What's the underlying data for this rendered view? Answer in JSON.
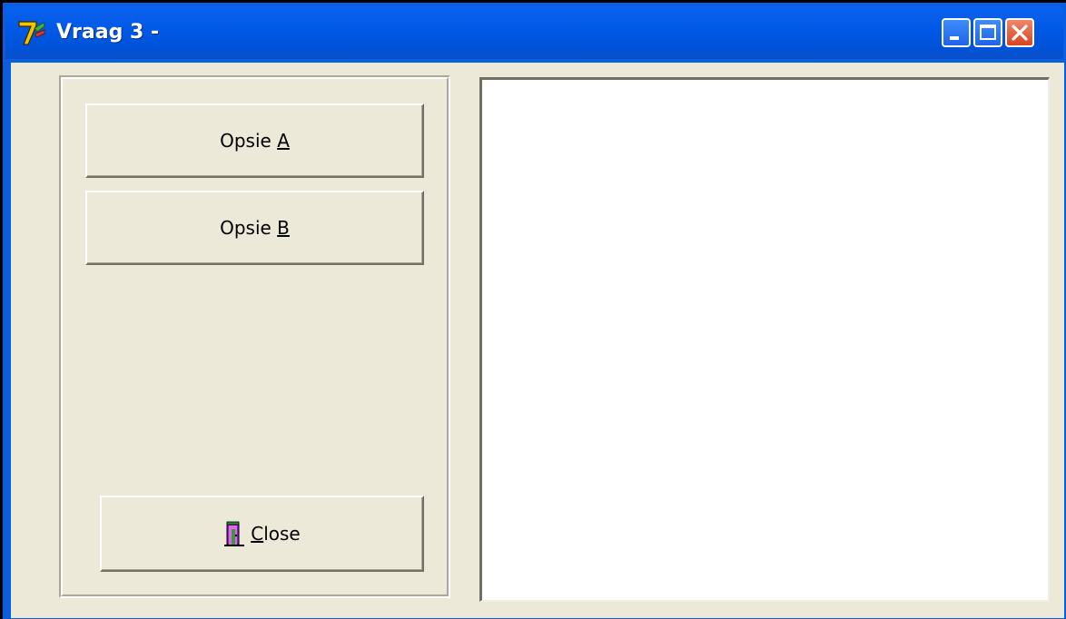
{
  "window": {
    "title": "Vraag 3 -",
    "icon": "app-logo-icon",
    "controls": [
      "minimize-icon",
      "maximize-icon",
      "close-icon"
    ]
  },
  "buttons": {
    "option_a": {
      "prefix": "Opsie ",
      "accel": "A",
      "suffix": ""
    },
    "option_b": {
      "prefix": "Opsie ",
      "accel": "B",
      "suffix": ""
    },
    "close": {
      "prefix": "",
      "accel": "C",
      "suffix": "lose",
      "icon": "exit-door-icon"
    }
  },
  "colors": {
    "titlebar": "#0058e6",
    "client_background": "#ece9d8",
    "close_button": "#d8451e",
    "content_background": "#ffffff"
  }
}
